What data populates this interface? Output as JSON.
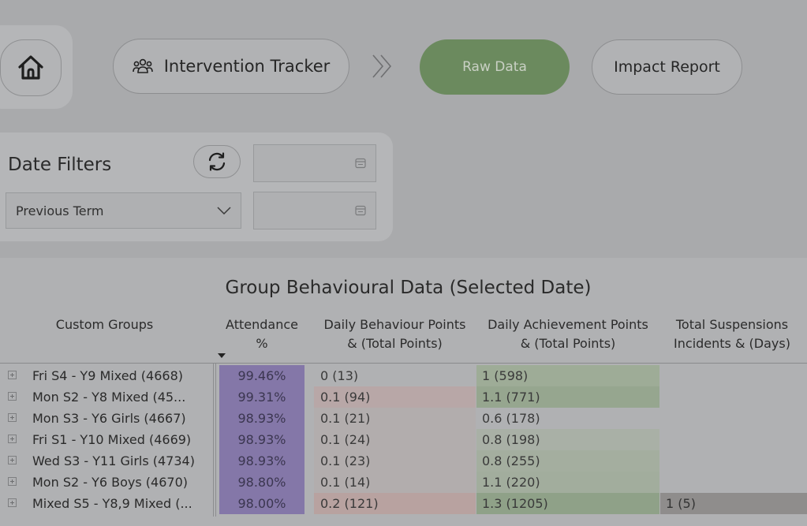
{
  "nav": {
    "home_icon": "home-icon",
    "tracker_icon": "group-icon",
    "tracker_label": "Intervention Tracker",
    "chevron_icon": "double-chevron-right-icon",
    "raw_data_label": "Raw Data",
    "impact_report_label": "Impact Report",
    "active_color": "#6b8a5e"
  },
  "filters": {
    "title": "Date Filters",
    "refresh_icon": "refresh-icon",
    "calendar_icon": "calendar-icon",
    "start_date": "",
    "end_date": "",
    "period_selected": "Previous Term"
  },
  "table": {
    "title": "Group Behavioural Data (Selected Date)",
    "headers": {
      "groups": "Custom Groups",
      "attendance_1": "Attendance",
      "attendance_2": "%",
      "behaviour_1": "Daily Behaviour Points",
      "behaviour_2": "& (Total Points)",
      "achievement_1": "Daily Achievement Points",
      "achievement_2": "& (Total Points)",
      "suspensions_1": "Total Suspensions",
      "suspensions_2": "Incidents & (Days)"
    },
    "rows": [
      {
        "name": "Fri S4 - Y9 Mixed (4668)",
        "attendance": "99.46%",
        "behaviour": "0 (13)",
        "achievement": "1 (598)",
        "suspensions": "",
        "beh_bg": "#b0b1b3",
        "ach_bg": "#9eac97",
        "sus_bg": "#b0b1b3"
      },
      {
        "name": "Mon S2 - Y8 Mixed (45...",
        "attendance": "99.31%",
        "behaviour": "0.1 (94)",
        "achievement": "1.1 (771)",
        "suspensions": "",
        "beh_bg": "#b8a7a7",
        "ach_bg": "#96a68f",
        "sus_bg": "#b0b1b3"
      },
      {
        "name": "Mon S3 - Y6 Girls (4667)",
        "attendance": "98.93%",
        "behaviour": "0.1 (21)",
        "achievement": "0.6 (178)",
        "suspensions": "",
        "beh_bg": "#b2adad",
        "ach_bg": "#b0b1b3",
        "sus_bg": "#b0b1b3"
      },
      {
        "name": "Fri S1 - Y10 Mixed (4669)",
        "attendance": "98.93%",
        "behaviour": "0.1 (24)",
        "achievement": "0.8 (198)",
        "suspensions": "",
        "beh_bg": "#b2adad",
        "ach_bg": "#a9b0a6",
        "sus_bg": "#b0b1b3"
      },
      {
        "name": "Wed S3 - Y11 Girls (4734)",
        "attendance": "98.93%",
        "behaviour": "0.1 (23)",
        "achievement": "0.8 (255)",
        "suspensions": "",
        "beh_bg": "#b2adad",
        "ach_bg": "#a4ae9f",
        "sus_bg": "#b0b1b3"
      },
      {
        "name": "Mon S2 - Y6 Boys (4670)",
        "attendance": "98.80%",
        "behaviour": "0.1 (14)",
        "achievement": "1.1 (220)",
        "suspensions": "",
        "beh_bg": "#b2adad",
        "ach_bg": "#a2ad9d",
        "sus_bg": "#b0b1b3"
      },
      {
        "name": "Mixed S5 - Y8,9 Mixed (...",
        "attendance": "98.00%",
        "behaviour": "0.2 (121)",
        "achievement": "1.3 (1205)",
        "suspensions": "1 (5)",
        "beh_bg": "#b8a2a0",
        "ach_bg": "#8fa188",
        "sus_bg": "#8f8d8c"
      }
    ]
  }
}
